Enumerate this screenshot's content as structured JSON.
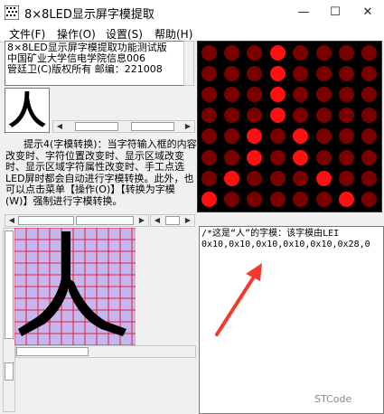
{
  "window": {
    "title": "8×8LED显示屏字模提取",
    "min_label": "—",
    "max_label": "☐",
    "close_label": "✕"
  },
  "menu": [
    {
      "label": "文件(F)"
    },
    {
      "label": "操作(O)"
    },
    {
      "label": "设置(S)"
    },
    {
      "label": "帮助(H)"
    }
  ],
  "info": {
    "line1": "8×8LED显示屏字模提取功能测试版",
    "line2": "中国矿业大学信电学院信息006",
    "line3": "管廷卫(C)版权所有 邮编：221008"
  },
  "preview_char": "人",
  "hint": "提示4(字模转换)：当字符输入框的内容改变时、字符位置改变时、显示区域改变时、显示区域字符属性改变时、手工点选LED屏时都会自动进行字模转换。此外，也可以点击菜单【操作(O)】【转换为字模(W)】强制进行字模转换。",
  "led": {
    "on_color": "#ff1010",
    "off_color": "#7a0000",
    "matrix": [
      "00010000",
      "00010000",
      "00010000",
      "00010000",
      "00101000",
      "00101000",
      "01000100",
      "10000010"
    ]
  },
  "code": {
    "line1": "/*这是“人”的字模：该字模由LEI",
    "line2": "0x10,0x10,0x10,0x10,0x10,0x28,0"
  },
  "watermark": "STCode"
}
